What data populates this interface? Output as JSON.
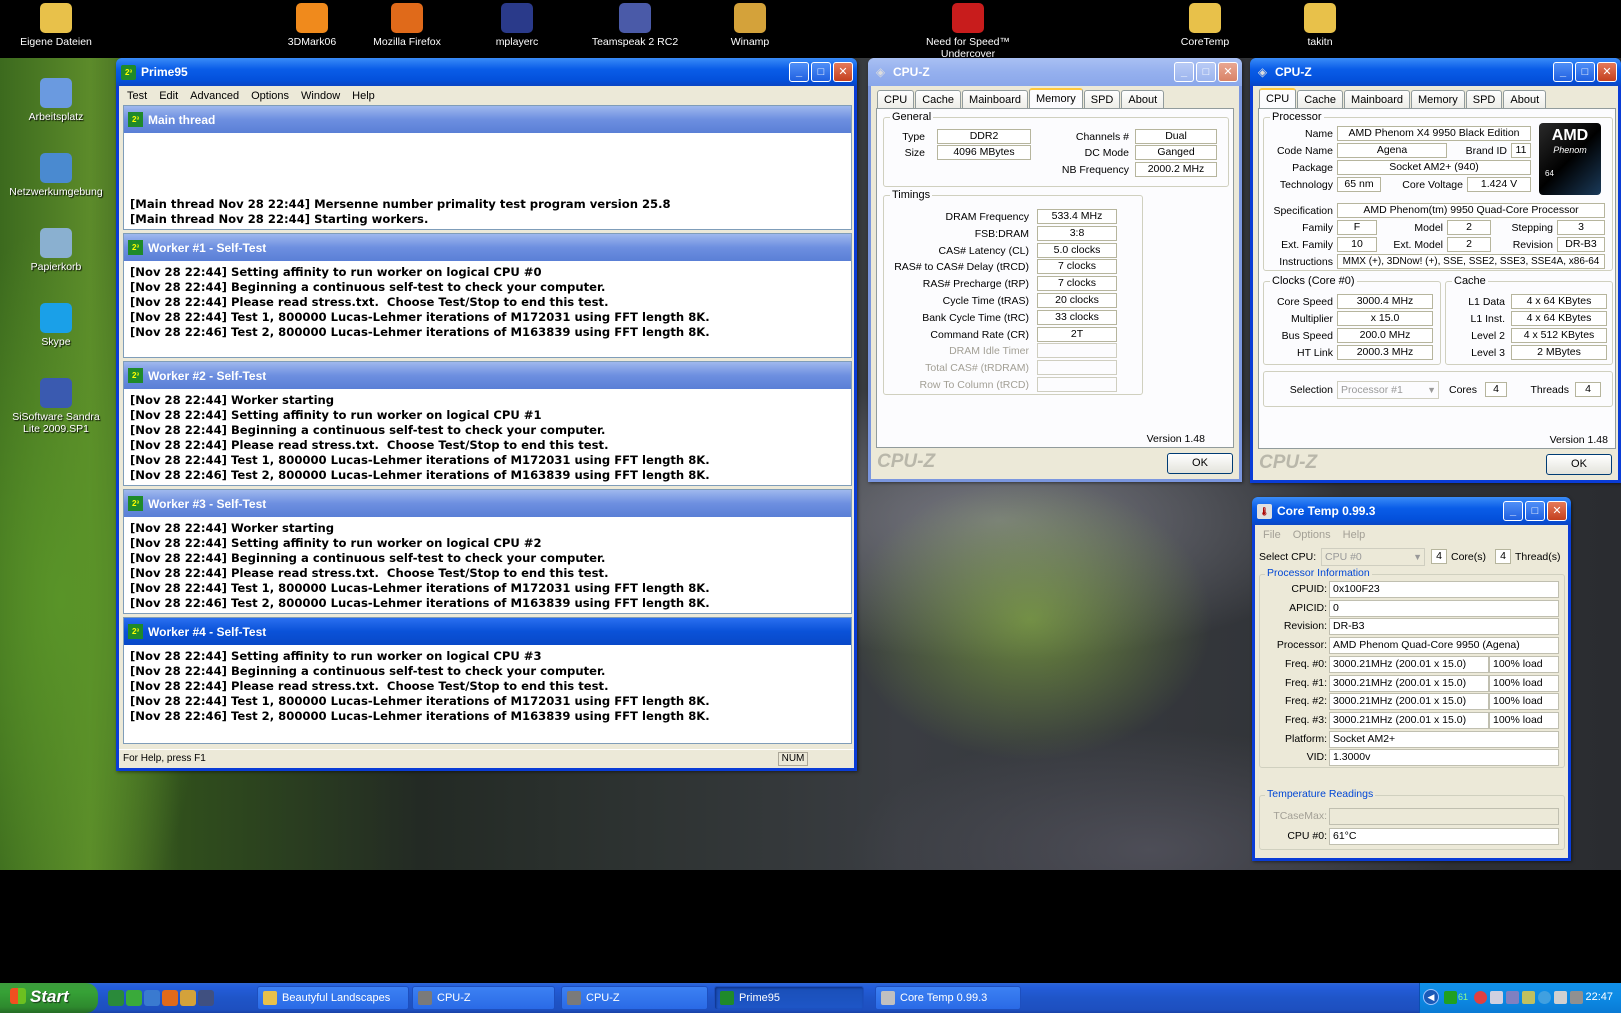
{
  "desktop": {
    "top_icons": [
      {
        "label": "Eigene Dateien",
        "icon": "folder-icon",
        "color": "#e8c14a"
      },
      {
        "label": "3DMark06",
        "icon": "3dmark-icon",
        "color": "#f08a1c"
      },
      {
        "label": "Mozilla Firefox",
        "icon": "firefox-icon",
        "color": "#e06a1a"
      },
      {
        "label": "mplayerc",
        "icon": "mplayer-icon",
        "color": "#2a3a8a"
      },
      {
        "label": "Teamspeak 2 RC2",
        "icon": "teamspeak-icon",
        "color": "#4a5aa8"
      },
      {
        "label": "Winamp",
        "icon": "winamp-icon",
        "color": "#d4a23a"
      },
      {
        "label": "Need for Speed™ Undercover",
        "icon": "nfs-icon",
        "color": "#c81c1c"
      },
      {
        "label": "CoreTemp",
        "icon": "folder-icon",
        "color": "#e8c14a"
      },
      {
        "label": "takitn",
        "icon": "folder-icon",
        "color": "#e8c14a"
      }
    ],
    "left_icons": [
      {
        "label": "Arbeitsplatz",
        "icon": "computer-icon",
        "color": "#6a9ae0"
      },
      {
        "label": "Netzwerkumgebung",
        "icon": "network-icon",
        "color": "#4a8ad0"
      },
      {
        "label": "Papierkorb",
        "icon": "recycle-bin-icon",
        "color": "#8ab0d0"
      },
      {
        "label": "Skype",
        "icon": "skype-icon",
        "color": "#1aa0e8"
      },
      {
        "label": "SiSoftware Sandra Lite 2009.SP1",
        "icon": "sandra-icon",
        "color": "#3a5ab0"
      }
    ]
  },
  "prime95": {
    "title": "Prime95",
    "menu": [
      "Test",
      "Edit",
      "Advanced",
      "Options",
      "Window",
      "Help"
    ],
    "panes": [
      {
        "title": "Main thread",
        "lines": [
          "",
          "",
          "",
          "",
          "[Main thread Nov 28 22:44] Mersenne number primality test program version 25.8",
          "[Main thread Nov 28 22:44] Starting workers."
        ]
      },
      {
        "title": "Worker #1 - Self-Test",
        "lines": [
          "[Nov 28 22:44] Setting affinity to run worker on logical CPU #0",
          "[Nov 28 22:44] Beginning a continuous self-test to check your computer.",
          "[Nov 28 22:44] Please read stress.txt.  Choose Test/Stop to end this test.",
          "[Nov 28 22:44] Test 1, 800000 Lucas-Lehmer iterations of M172031 using FFT length 8K.",
          "[Nov 28 22:46] Test 2, 800000 Lucas-Lehmer iterations of M163839 using FFT length 8K."
        ]
      },
      {
        "title": "Worker #2 - Self-Test",
        "lines": [
          "[Nov 28 22:44] Worker starting",
          "[Nov 28 22:44] Setting affinity to run worker on logical CPU #1",
          "[Nov 28 22:44] Beginning a continuous self-test to check your computer.",
          "[Nov 28 22:44] Please read stress.txt.  Choose Test/Stop to end this test.",
          "[Nov 28 22:44] Test 1, 800000 Lucas-Lehmer iterations of M172031 using FFT length 8K.",
          "[Nov 28 22:46] Test 2, 800000 Lucas-Lehmer iterations of M163839 using FFT length 8K."
        ]
      },
      {
        "title": "Worker #3 - Self-Test",
        "lines": [
          "[Nov 28 22:44] Worker starting",
          "[Nov 28 22:44] Setting affinity to run worker on logical CPU #2",
          "[Nov 28 22:44] Beginning a continuous self-test to check your computer.",
          "[Nov 28 22:44] Please read stress.txt.  Choose Test/Stop to end this test.",
          "[Nov 28 22:44] Test 1, 800000 Lucas-Lehmer iterations of M172031 using FFT length 8K.",
          "[Nov 28 22:46] Test 2, 800000 Lucas-Lehmer iterations of M163839 using FFT length 8K."
        ]
      },
      {
        "title": "Worker #4 - Self-Test",
        "lines": [
          "[Nov 28 22:44] Setting affinity to run worker on logical CPU #3",
          "[Nov 28 22:44] Beginning a continuous self-test to check your computer.",
          "[Nov 28 22:44] Please read stress.txt.  Choose Test/Stop to end this test.",
          "[Nov 28 22:44] Test 1, 800000 Lucas-Lehmer iterations of M172031 using FFT length 8K.",
          "[Nov 28 22:46] Test 2, 800000 Lucas-Lehmer iterations of M163839 using FFT length 8K."
        ]
      }
    ],
    "status": "For Help, press F1",
    "num": "NUM"
  },
  "cpuz_mem": {
    "title": "CPU-Z",
    "tabs": [
      "CPU",
      "Cache",
      "Mainboard",
      "Memory",
      "SPD",
      "About"
    ],
    "general_legend": "General",
    "type_label": "Type",
    "type": "DDR2",
    "size_label": "Size",
    "size": "4096 MBytes",
    "channels_label": "Channels #",
    "channels": "Dual",
    "dcmode_label": "DC Mode",
    "dcmode": "Ganged",
    "nbfreq_label": "NB Frequency",
    "nbfreq": "2000.2 MHz",
    "timings_legend": "Timings",
    "timings": [
      {
        "label": "DRAM Frequency",
        "value": "533.4 MHz"
      },
      {
        "label": "FSB:DRAM",
        "value": "3:8"
      },
      {
        "label": "CAS# Latency (CL)",
        "value": "5.0 clocks"
      },
      {
        "label": "RAS# to CAS# Delay (tRCD)",
        "value": "7 clocks"
      },
      {
        "label": "RAS# Precharge (tRP)",
        "value": "7 clocks"
      },
      {
        "label": "Cycle Time (tRAS)",
        "value": "20 clocks"
      },
      {
        "label": "Bank Cycle Time (tRC)",
        "value": "33 clocks"
      },
      {
        "label": "Command Rate (CR)",
        "value": "2T"
      },
      {
        "label": "DRAM Idle Timer",
        "value": ""
      },
      {
        "label": "Total CAS# (tRDRAM)",
        "value": ""
      },
      {
        "label": "Row To Column (tRCD)",
        "value": ""
      }
    ],
    "version": "Version 1.48",
    "logo": "CPU-Z",
    "ok": "OK"
  },
  "cpuz_cpu": {
    "title": "CPU-Z",
    "tabs": [
      "CPU",
      "Cache",
      "Mainboard",
      "Memory",
      "SPD",
      "About"
    ],
    "processor_legend": "Processor",
    "name_label": "Name",
    "name": "AMD Phenom X4 9950 Black Edition",
    "codename_label": "Code Name",
    "codename": "Agena",
    "brandid_label": "Brand ID",
    "brandid": "11",
    "package_label": "Package",
    "package": "Socket AM2+ (940)",
    "technology_label": "Technology",
    "technology": "65 nm",
    "voltage_label": "Core Voltage",
    "voltage": "1.424 V",
    "spec_label": "Specification",
    "spec": "AMD Phenom(tm) 9950 Quad-Core Processor",
    "family_label": "Family",
    "family": "F",
    "model_label": "Model",
    "model": "2",
    "stepping_label": "Stepping",
    "stepping": "3",
    "extfamily_label": "Ext. Family",
    "extfamily": "10",
    "extmodel_label": "Ext. Model",
    "extmodel": "2",
    "revision_label": "Revision",
    "revision": "DR-B3",
    "instr_label": "Instructions",
    "instr": "MMX (+), 3DNow! (+), SSE, SSE2, SSE3, SSE4A, x86-64",
    "clocks_legend": "Clocks (Core #0)",
    "corespeed_label": "Core Speed",
    "corespeed": "3000.4 MHz",
    "multiplier_label": "Multiplier",
    "multiplier": "x 15.0",
    "busspeed_label": "Bus Speed",
    "busspeed": "200.0 MHz",
    "htlink_label": "HT Link",
    "htlink": "2000.3 MHz",
    "cache_legend": "Cache",
    "l1d_label": "L1 Data",
    "l1d": "4 x 64 KBytes",
    "l1i_label": "L1 Inst.",
    "l1i": "4 x 64 KBytes",
    "l2_label": "Level 2",
    "l2": "4 x 512 KBytes",
    "l3_label": "Level 3",
    "l3": "2 MBytes",
    "selection_label": "Selection",
    "selection": "Processor #1",
    "cores_label": "Cores",
    "cores": "4",
    "threads_label": "Threads",
    "threads": "4",
    "logo_text1": "AMD",
    "logo_text2": "Phenom",
    "logo_text3": "64",
    "version": "Version 1.48",
    "logo": "CPU-Z",
    "ok": "OK"
  },
  "coretemp": {
    "title": "Core Temp 0.99.3",
    "menu": [
      "File",
      "Options",
      "Help"
    ],
    "selectcpu_label": "Select CPU:",
    "selectcpu": "CPU #0",
    "cores": "4",
    "cores_label": "Core(s)",
    "threads": "4",
    "threads_label": "Thread(s)",
    "procinfo_label": "Processor Information",
    "rows": [
      {
        "label": "CPUID:",
        "value": "0x100F23",
        "load": ""
      },
      {
        "label": "APICID:",
        "value": "0",
        "load": ""
      },
      {
        "label": "Revision:",
        "value": "DR-B3",
        "load": ""
      },
      {
        "label": "Processor:",
        "value": "AMD Phenom Quad-Core 9950 (Agena)",
        "load": ""
      },
      {
        "label": "Freq. #0:",
        "value": "3000.21MHz (200.01 x 15.0)",
        "load": "100% load"
      },
      {
        "label": "Freq. #1:",
        "value": "3000.21MHz (200.01 x 15.0)",
        "load": "100% load"
      },
      {
        "label": "Freq. #2:",
        "value": "3000.21MHz (200.01 x 15.0)",
        "load": "100% load"
      },
      {
        "label": "Freq. #3:",
        "value": "3000.21MHz (200.01 x 15.0)",
        "load": "100% load"
      },
      {
        "label": "Platform:",
        "value": "Socket AM2+",
        "load": ""
      },
      {
        "label": "VID:",
        "value": "1.3000v",
        "load": ""
      }
    ],
    "temps_label": "Temperature Readings",
    "tcasemax_label": "TCaseMax:",
    "tcasemax": "",
    "cpu0_label": "CPU #0:",
    "cpu0": "61°C"
  },
  "taskbar": {
    "start": "Start",
    "quicklaunch": [
      {
        "icon": "show-desktop-icon",
        "color": "#2a8a3a"
      },
      {
        "icon": "app-icon",
        "color": "#3aaa3a"
      },
      {
        "icon": "app-icon",
        "color": "#3a7ad0"
      },
      {
        "icon": "firefox-icon",
        "color": "#e06a1a"
      },
      {
        "icon": "winamp-icon",
        "color": "#d4a23a"
      },
      {
        "icon": "app-icon",
        "color": "#405080"
      }
    ],
    "tasks": [
      {
        "label": "Beautyful Landscapes",
        "icon": "folder-icon",
        "color": "#e8c14a",
        "active": false
      },
      {
        "label": "CPU-Z",
        "icon": "cpuz-icon",
        "color": "#7a7a7a",
        "active": false
      },
      {
        "label": "CPU-Z",
        "icon": "cpuz-icon",
        "color": "#7a7a7a",
        "active": false
      },
      {
        "label": "Prime95",
        "icon": "prime95-icon",
        "color": "#1f8a2a",
        "active": true
      },
      {
        "label": "Core Temp 0.99.3",
        "icon": "coretemp-icon",
        "color": "#c0c0c0",
        "active": false
      }
    ],
    "tray_badge": "61",
    "clock": "22:47"
  }
}
